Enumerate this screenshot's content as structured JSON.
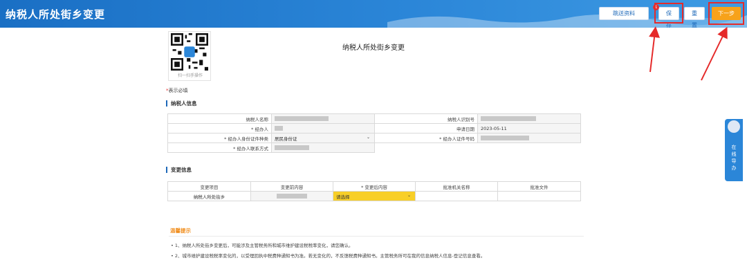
{
  "app": {
    "title": "纳税人所处街乡变更"
  },
  "toolbar": {
    "send_label": "跳送资料",
    "save_label": "保存",
    "reset_label": "重置",
    "next_label": "下一步",
    "save_badge": "1"
  },
  "qr": {
    "caption": "扫一扫手操作"
  },
  "form": {
    "title": "纳税人所处街乡变更",
    "required_note": "表示必填",
    "required_mark": "*"
  },
  "taxpayer": {
    "section_title": "纳税人信息",
    "name_label": "纳税人名称",
    "id_label": "纳税人识别号",
    "agent_label": "* 经办人",
    "apply_date_label": "申请日期",
    "apply_date_value": "2023-05-11",
    "id_type_label": "* 经办人身份证件种类",
    "id_type_value": "居民身份证",
    "id_no_label": "* 经办人证件号码",
    "contact_label": "* 经办人联系方式"
  },
  "change": {
    "section_title": "变更信息",
    "headers": [
      "变更项目",
      "变更前内容",
      "* 变更后内容",
      "批准机关名称",
      "批准文件"
    ],
    "row_item": "纳税人所处街乡",
    "after_placeholder": "请选择"
  },
  "tips": {
    "title": "温馨提示",
    "items": [
      "• 1、纳税人所处街乡变更后，可能涉及主管税务所和城市维护建设税税率变化，请您确认。",
      "• 2、城市维护建设税税率变化的，以受理回执中税费种通知书为准。若无变化的，不反馈税费种通知书。主管税务所可在我的信息纳税人信息-登记信息查看。"
    ]
  },
  "helper": {
    "label_lines": [
      "在",
      "线",
      "导",
      "办"
    ]
  },
  "colors": {
    "brand_blue": "#1d68b8",
    "accent_orange": "#f7a21a",
    "highlight_red": "#e52a2a",
    "select_yellow": "#f8cf27"
  }
}
